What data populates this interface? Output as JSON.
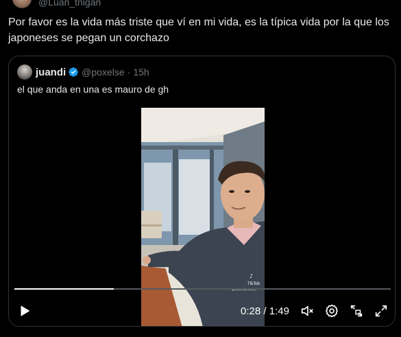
{
  "top": {
    "handle": "@Luan_tnigan"
  },
  "tweet": {
    "text": "Por favor es la vida más triste que ví en mi vida, es la típica vida por la que los japoneses se pegan un corchazo"
  },
  "quote": {
    "name": "juandi",
    "handle": "@poxelse",
    "dot": "·",
    "time": "15h",
    "text": "el que anda en una es mauro de gh",
    "verified_color": "#1d9bf0"
  },
  "video": {
    "watermark_brand": "TikTok",
    "watermark_user": "@stalendomauro_",
    "progress_fraction": 0.265,
    "time_current": "0:28",
    "time_separator": " / ",
    "time_total": "1:49"
  },
  "colors": {
    "accent": "#1d9bf0",
    "text": "#e7e9ea",
    "muted": "#71767b",
    "border": "#2f3336"
  }
}
